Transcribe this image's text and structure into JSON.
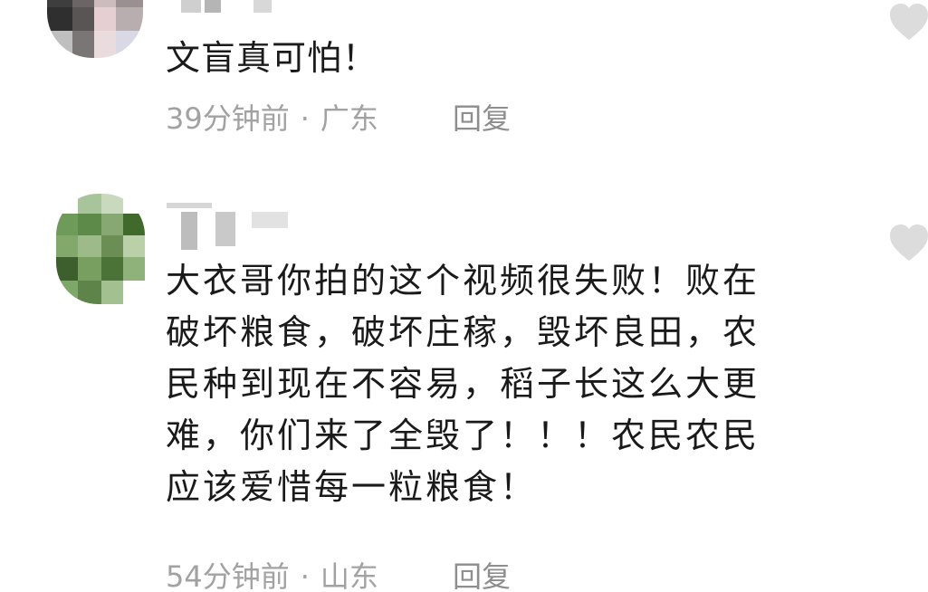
{
  "comments": [
    {
      "text": "文盲真可怕！",
      "time": "39分钟前",
      "separator": "·",
      "location": "广东",
      "reply_label": "回复",
      "like_icon": "heart-outline-icon"
    },
    {
      "lines": [
        "大衣哥你拍的这个视频很失败！败在",
        "破坏粮食，破坏庄稼，毁坏良田，农",
        "民种到现在不容易，稻子长这么大更",
        "难，你们来了全毁了！！！农民农民",
        "应该爱惜每一粒粮食！"
      ],
      "time": "54分钟前",
      "separator": "·",
      "location": "山东",
      "reply_label": "回复",
      "like_icon": "heart-outline-icon"
    }
  ],
  "colors": {
    "text_primary": "#1a1a1a",
    "text_meta": "#a2a2a2",
    "text_reply": "#8e8e8e",
    "like_icon": "#dcdcdc"
  }
}
